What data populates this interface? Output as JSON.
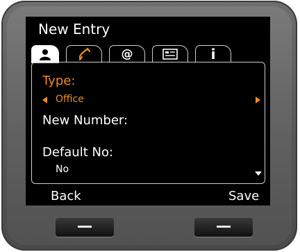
{
  "header": {
    "title": "New Entry"
  },
  "tabs": [
    {
      "icon": "person-icon",
      "label": ""
    },
    {
      "icon": "phone-handset-icon",
      "label": ""
    },
    {
      "icon": "at-sign-icon",
      "label": "@"
    },
    {
      "icon": "contact-card-icon",
      "label": ""
    },
    {
      "icon": "info-icon",
      "label": "i"
    }
  ],
  "form": {
    "type_label": "Type:",
    "type_value": "Office",
    "new_number_label": "New Number:",
    "default_no_label": "Default No:",
    "default_no_value": "No"
  },
  "softkeys": {
    "left": "Back",
    "right": "Save"
  },
  "colors": {
    "accent": "#f08a24",
    "screen_bg": "#000000",
    "text": "#ffffff"
  }
}
